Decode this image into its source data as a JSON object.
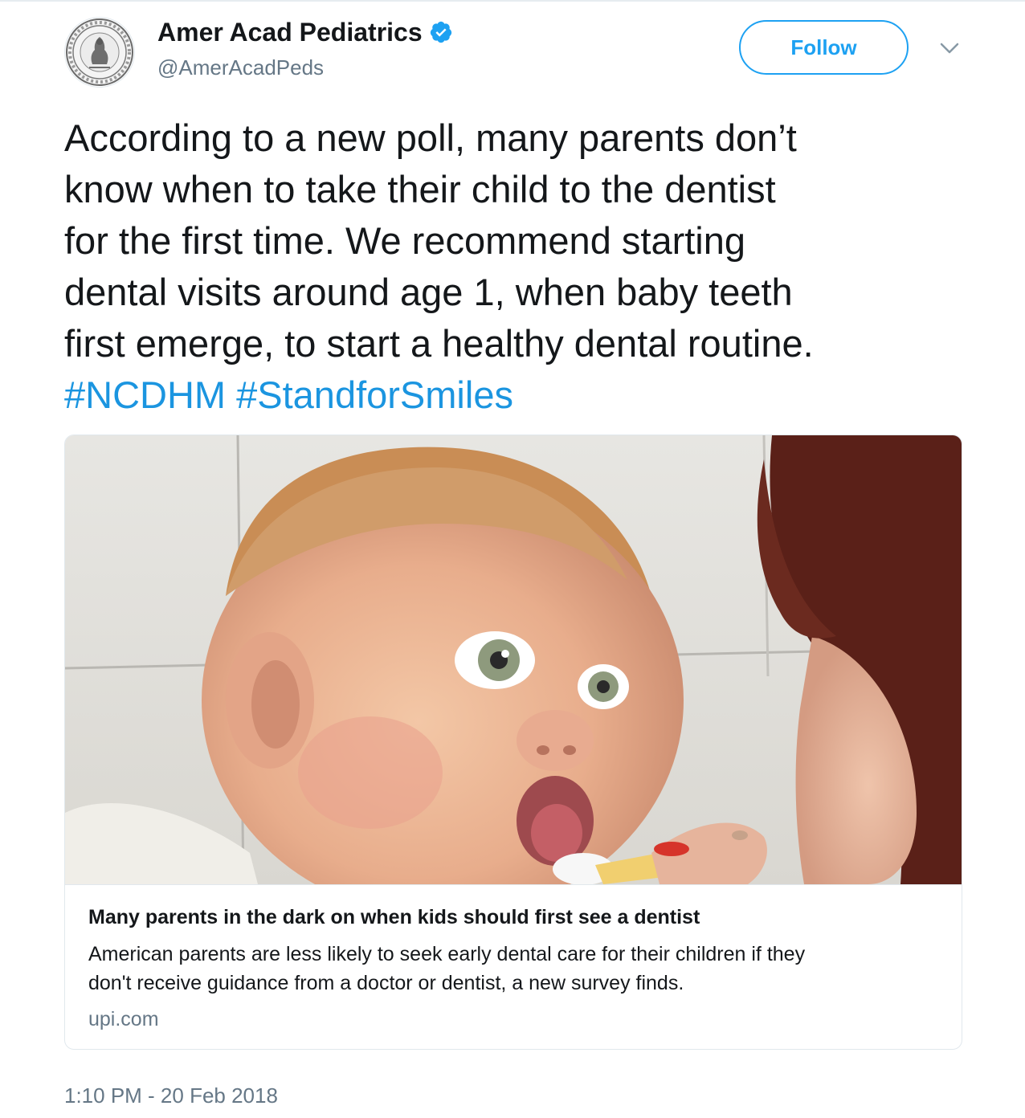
{
  "author": {
    "display_name": "Amer Acad Pediatrics",
    "handle": "@AmerAcadPeds",
    "verified": true,
    "avatar_icon": "aap-seal-icon"
  },
  "actions": {
    "follow_label": "Follow",
    "menu_icon": "chevron-down-icon"
  },
  "tweet": {
    "lines": [
      "According to a new poll, many parents don’t",
      "know when to take their child to the dentist",
      "for the first time. We recommend starting",
      "dental visits around age 1, when baby teeth",
      "first emerge, to start a healthy dental routine."
    ],
    "hashtags": [
      "#NCDHM",
      "#StandforSmiles"
    ]
  },
  "card": {
    "title": "Many parents in the dark on when kids should first see a dentist",
    "description_lines": [
      "American parents are less likely to seek early dental care for their children if they",
      "don't receive guidance from a doctor or dentist, a new survey finds."
    ],
    "domain": "upi.com"
  },
  "timestamp": "1:10 PM - 20 Feb 2018",
  "colors": {
    "link": "#1b95e0",
    "accent": "#1da1f2",
    "secondary_text": "#657786",
    "border": "#e1e8ed"
  }
}
